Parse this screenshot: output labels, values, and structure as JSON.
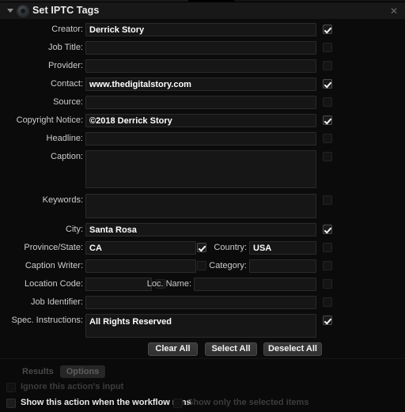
{
  "window": {
    "title": "Set IPTC Tags",
    "disclosure_icon": "triangle-down-icon",
    "app_icon": "aperture-icon",
    "close_icon": "close-icon"
  },
  "form": {
    "rows": [
      {
        "label": "Creator:",
        "value": "Derrick Story",
        "checked": true,
        "type": "text"
      },
      {
        "label": "Job Title:",
        "value": "",
        "checked": false,
        "type": "text"
      },
      {
        "label": "Provider:",
        "value": "",
        "checked": false,
        "type": "text"
      },
      {
        "label": "Contact:",
        "value": "www.thedigitalstory.com",
        "checked": true,
        "type": "text"
      },
      {
        "label": "Source:",
        "value": "",
        "checked": false,
        "type": "text"
      },
      {
        "label": "Copyright Notice:",
        "value": "©2018 Derrick Story",
        "checked": true,
        "type": "text"
      },
      {
        "label": "Headline:",
        "value": "",
        "checked": false,
        "type": "text"
      },
      {
        "label": "Caption:",
        "value": "",
        "checked": false,
        "type": "textarea"
      },
      {
        "label": "Keywords:",
        "value": "",
        "checked": false,
        "type": "textarea"
      },
      {
        "label": "City:",
        "value": "Santa Rosa",
        "checked": true,
        "type": "text"
      }
    ],
    "paired_rows": [
      {
        "left_label": "Province/State:",
        "left_value": "CA",
        "left_checked": true,
        "right_label": "Country:",
        "right_value": "USA",
        "right_checked": false
      },
      {
        "left_label": "Caption Writer:",
        "left_value": "",
        "left_checked": false,
        "right_label": "Category:",
        "right_value": "",
        "right_checked": false
      },
      {
        "left_label": "Location Code:",
        "left_value": "",
        "left_checked": false,
        "right_label": "Loc. Name:",
        "right_value": "",
        "right_checked": false
      }
    ],
    "tail_rows": [
      {
        "label": "Job Identifier:",
        "value": "",
        "checked": false,
        "type": "text"
      },
      {
        "label": "Spec. Instructions:",
        "value": "All Rights Reserved",
        "checked": true,
        "type": "textarea"
      }
    ]
  },
  "buttons": {
    "clear_all": "Clear All",
    "select_all": "Select All",
    "deselect_all": "Deselect All"
  },
  "footer": {
    "tabs": [
      {
        "label": "Results",
        "selected": false
      },
      {
        "label": "Options",
        "selected": true
      }
    ],
    "checkboxes": [
      {
        "label": "Ignore this action's input",
        "checked": false,
        "enabled": false
      },
      {
        "label": "Show this action when the workflow runs",
        "checked": false,
        "enabled": true
      },
      {
        "label": "Show only the selected items",
        "checked": false,
        "enabled": false
      }
    ]
  },
  "colors": {
    "background": "#0a0a0a",
    "titlebar": "#181818",
    "field_bg": "#161616",
    "field_border": "#2b2b2b",
    "text": "#ececec",
    "label": "#cdcdcd",
    "dim_text": "#3c3c3c"
  }
}
